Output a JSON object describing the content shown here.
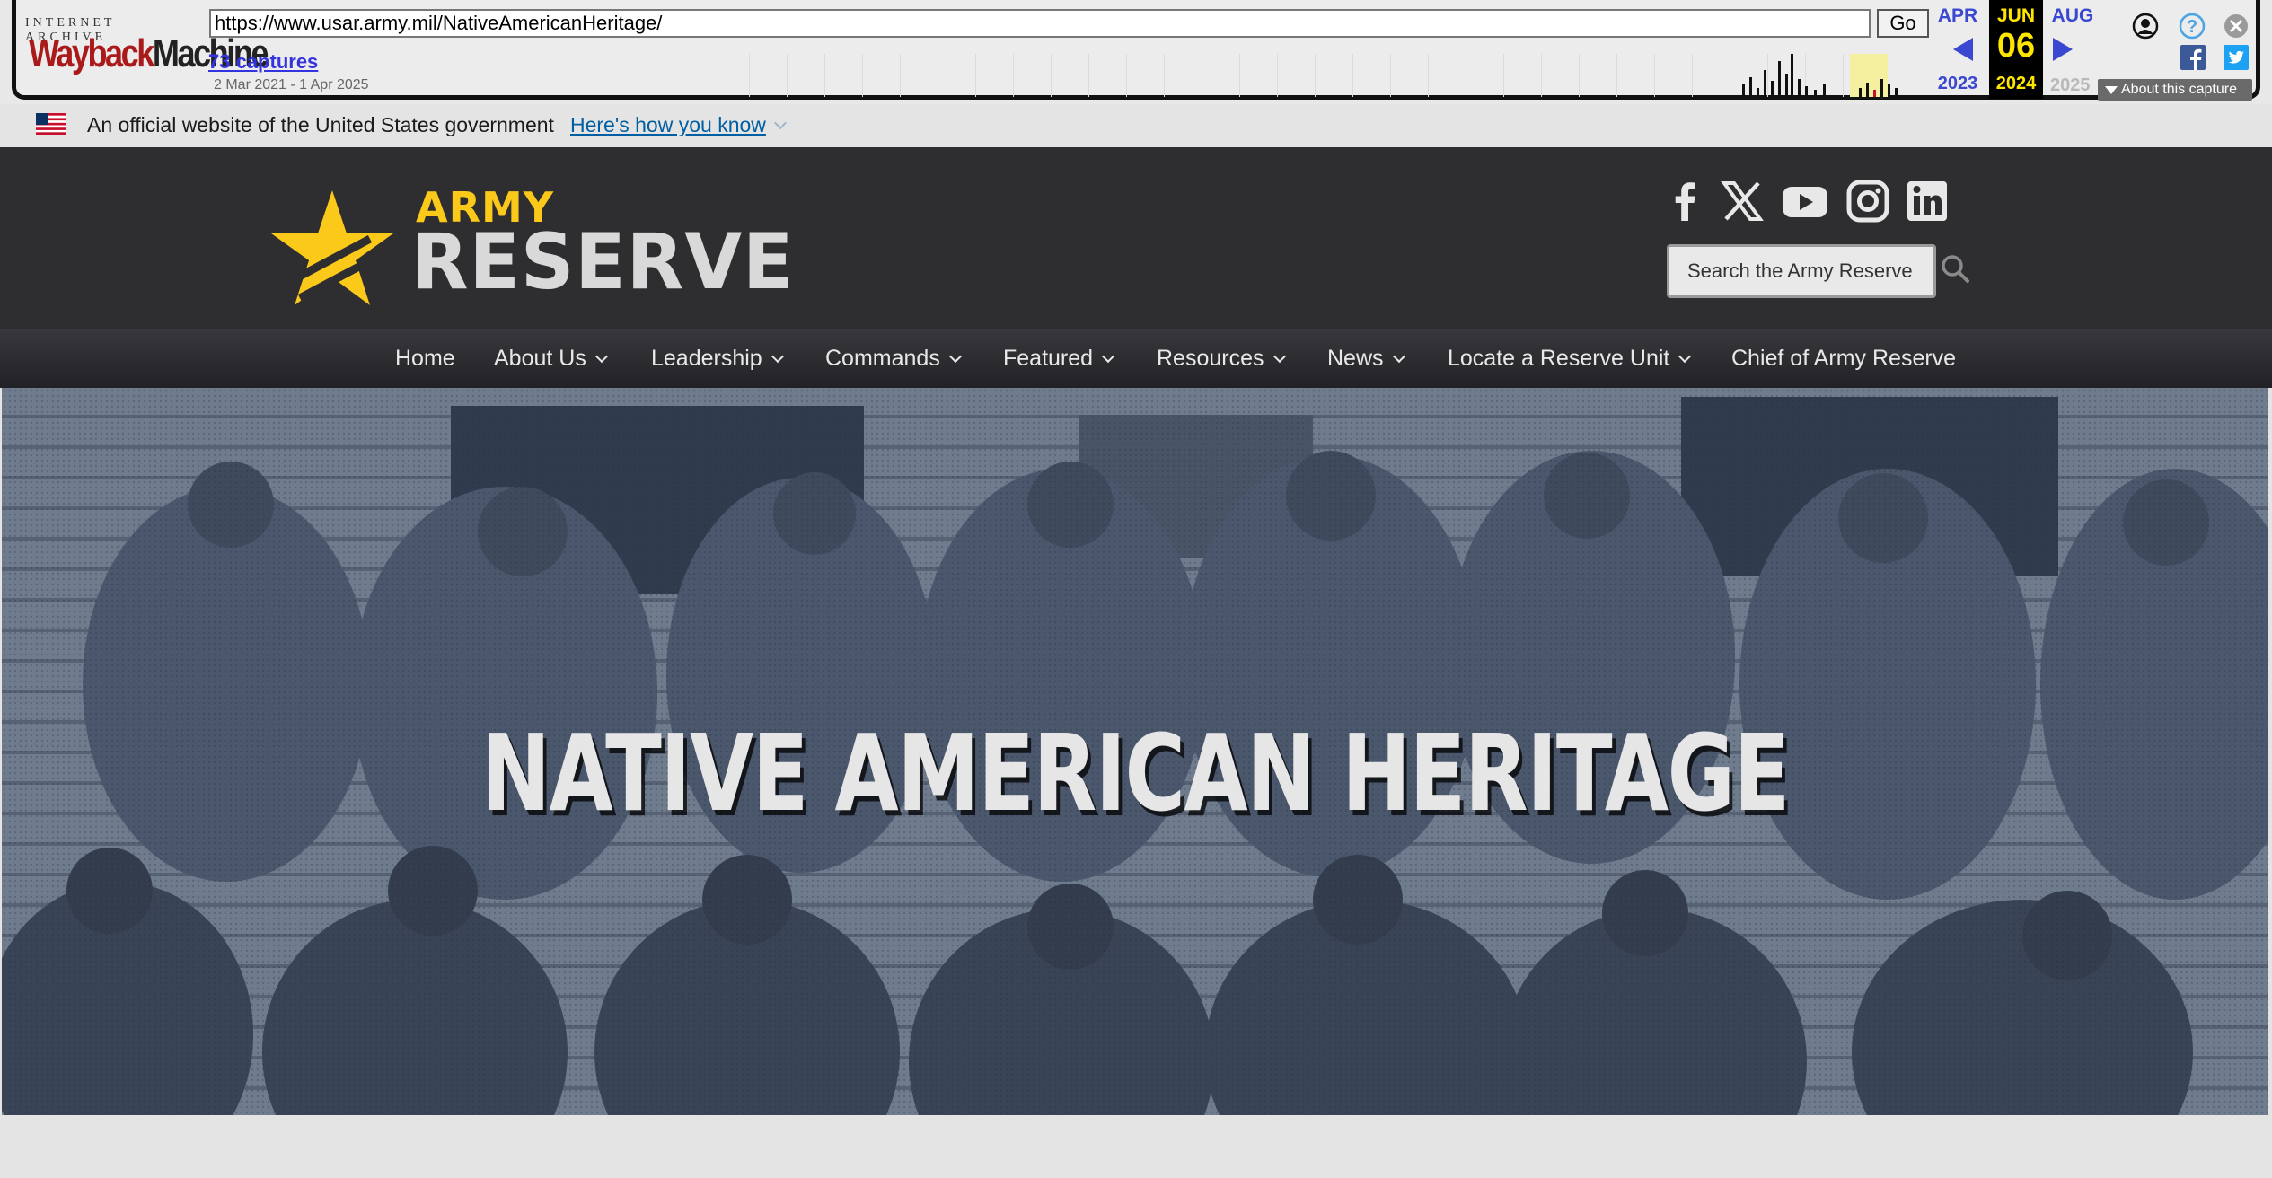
{
  "wayback": {
    "logo_top": "INTERNET ARCHIVE",
    "logo_way": "Wayback",
    "logo_machine": "Machine",
    "url": "https://www.usar.army.mil/NativeAmericanHeritage/",
    "go_label": "Go",
    "captures": "73 captures",
    "date_range": "2 Mar 2021 - 1 Apr 2025",
    "prev_month": "APR",
    "prev_year": "2023",
    "current_month": "JUN",
    "current_day": "06",
    "current_year": "2024",
    "next_month": "AUG",
    "next_year": "2025",
    "about_capture": "About this capture",
    "icons": [
      "user-icon",
      "help-icon",
      "close-icon",
      "facebook-icon",
      "twitter-icon"
    ],
    "sparkline_year_highlight_color": "#f4f0a0"
  },
  "gov_banner": {
    "text": "An official website of the United States government",
    "link": "Here's how you know"
  },
  "header": {
    "logo_line1": "ARMY",
    "logo_line2": "RESERVE",
    "social_icons": [
      "facebook-icon",
      "x-icon",
      "youtube-icon",
      "instagram-icon",
      "linkedin-icon"
    ],
    "search_placeholder": "Search the Army Reserve"
  },
  "nav": {
    "items": [
      {
        "label": "Home",
        "dropdown": false
      },
      {
        "label": "About Us",
        "dropdown": true
      },
      {
        "label": "Leadership",
        "dropdown": true
      },
      {
        "label": "Commands",
        "dropdown": true
      },
      {
        "label": "Featured",
        "dropdown": true
      },
      {
        "label": "Resources",
        "dropdown": true
      },
      {
        "label": "News",
        "dropdown": true
      },
      {
        "label": "Locate a Reserve Unit",
        "dropdown": true
      },
      {
        "label": "Chief of Army Reserve",
        "dropdown": false
      }
    ]
  },
  "hero": {
    "title": "NATIVE AMERICAN HERITAGE"
  },
  "colors": {
    "header_bg": "#2e2d2f",
    "brand_yellow": "#fbc91a",
    "gov_link": "#005ea2",
    "wayback_blue": "#3a47d0",
    "hero_tint": "#6a7584"
  }
}
